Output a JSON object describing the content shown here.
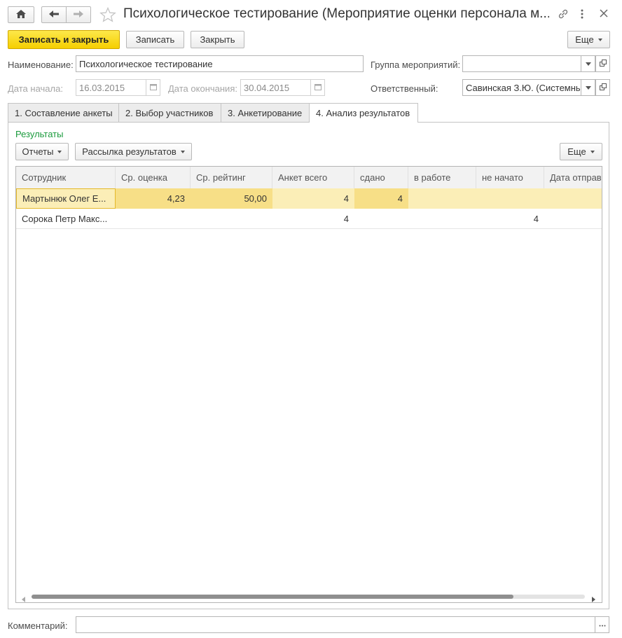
{
  "window": {
    "title": "Психологическое тестирование (Мероприятие оценки персонала м..."
  },
  "toolbar": {
    "save_close_label": "Записать и закрыть",
    "save_label": "Записать",
    "close_label": "Закрыть",
    "more_label": "Еще"
  },
  "form": {
    "name_label": "Наименование:",
    "name_value": "Психологическое тестирование",
    "group_label": "Группа мероприятий:",
    "group_value": "",
    "start_label": "Дата начала:",
    "start_value": "16.03.2015",
    "end_label": "Дата окончания:",
    "end_value": "30.04.2015",
    "responsible_label": "Ответственный:",
    "responsible_value": "Савинская З.Ю. (Системны"
  },
  "tabs": [
    {
      "label": "1. Составление анкеты"
    },
    {
      "label": "2. Выбор участников"
    },
    {
      "label": "3. Анкетирование"
    },
    {
      "label": "4. Анализ результатов"
    }
  ],
  "results": {
    "group_title": "Результаты",
    "reports_label": "Отчеты",
    "mailing_label": "Рассылка результатов",
    "more_label": "Еще",
    "columns": [
      "Сотрудник",
      "Ср. оценка",
      "Ср. рейтинг",
      "Анкет всего",
      "сдано",
      "в работе",
      "не начато",
      "Дата отправи"
    ],
    "rows": [
      [
        "Мартынюк Олег Е...",
        "4,23",
        "50,00",
        "4",
        "4",
        "",
        "",
        ""
      ],
      [
        "Сорока Петр Макс...",
        "",
        "",
        "4",
        "",
        "",
        "4",
        ""
      ]
    ]
  },
  "comment": {
    "label": "Комментарий:",
    "value": ""
  },
  "colors": {
    "primary_button": "#f5cf00",
    "selected_row": "#fbeeb7",
    "group_title": "#1a9a3c"
  },
  "icons": [
    "home-icon",
    "back-arrow-icon",
    "forward-arrow-icon",
    "star-icon",
    "link-icon",
    "menu-dots-icon",
    "close-icon",
    "calendar-icon",
    "dropdown-icon",
    "open-icon"
  ]
}
